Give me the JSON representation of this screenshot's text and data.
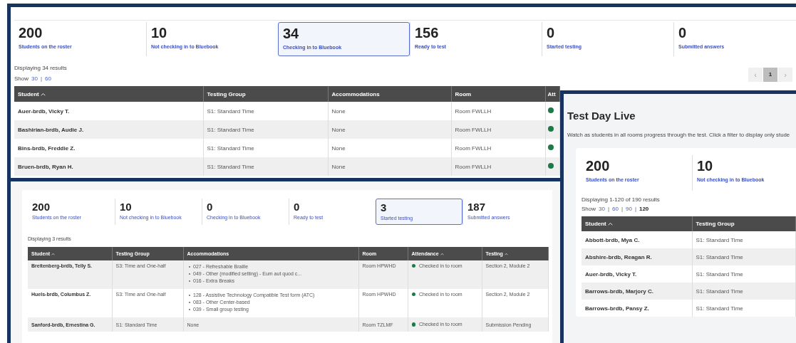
{
  "panels": [
    {
      "stats": [
        {
          "value": "200",
          "label": "Students on the roster",
          "selected": false
        },
        {
          "value": "10",
          "label": "Not checking in to Bluebook",
          "selected": false
        },
        {
          "value": "34",
          "label": "Checking in to Bluebook",
          "selected": true
        },
        {
          "value": "156",
          "label": "Ready to test",
          "selected": false
        },
        {
          "value": "0",
          "label": "Started testing",
          "selected": false
        },
        {
          "value": "0",
          "label": "Submitted answers",
          "selected": false
        }
      ],
      "results": "Displaying 34 results",
      "page_sizes": {
        "label": "Show",
        "separator": "|",
        "options": [
          {
            "label": "30",
            "selected": false
          },
          {
            "label": "60",
            "selected": false
          }
        ]
      },
      "pager": {
        "prev": "‹",
        "pages": [
          {
            "label": "1",
            "selected": true
          }
        ],
        "next": "›"
      },
      "table": {
        "columns": [
          {
            "label": "Student",
            "kind": "name",
            "sorted": true
          },
          {
            "label": "Testing Group",
            "kind": "text",
            "sorted": false
          },
          {
            "label": "Accommodations",
            "kind": "list",
            "sorted": false
          },
          {
            "label": "Room",
            "kind": "text",
            "sorted": false
          },
          {
            "label": "Att",
            "kind": "status"
          }
        ],
        "rows": [
          [
            "Auer-brdb, Vicky T.",
            "S1: Standard Time",
            "None",
            "Room FWLLH",
            true
          ],
          [
            "Bashirian-brdb, Audie J.",
            "S1: Standard Time",
            "None",
            "Room FWLLH",
            true
          ],
          [
            "Bins-brdb, Freddie Z.",
            "S1: Standard Time",
            "None",
            "Room FWLLH",
            true
          ],
          [
            "Bruen-brdb, Ryan H.",
            "S1: Standard Time",
            "None",
            "Room FWLLH",
            true
          ]
        ]
      }
    },
    {
      "stats": [
        {
          "value": "200",
          "label": "Students on the roster",
          "selected": false
        },
        {
          "value": "10",
          "label": "Not checking in to Bluebook",
          "selected": false
        },
        {
          "value": "0",
          "label": "Checking in to Bluebook",
          "selected": false
        },
        {
          "value": "0",
          "label": "Ready to test",
          "selected": false
        },
        {
          "value": "3",
          "label": "Started testing",
          "selected": true
        },
        {
          "value": "187",
          "label": "Submitted answers",
          "selected": false
        }
      ],
      "results": "Displaying 3 results",
      "table": {
        "columns": [
          {
            "label": "Student",
            "kind": "name",
            "sorted": true
          },
          {
            "label": "Testing Group",
            "kind": "text",
            "sorted": false
          },
          {
            "label": "Accommodations",
            "kind": "list",
            "sorted": false
          },
          {
            "label": "Room",
            "kind": "text",
            "sorted": false
          },
          {
            "label": "Attendance",
            "kind": "status",
            "sorted": true
          },
          {
            "label": "Testing",
            "kind": "text",
            "sorted": true
          }
        ],
        "rows": [
          [
            "Breitenberg-brdb, Telly S.",
            "S3: Time and One-half",
            [
              "027 - Refreshable Braille",
              "049 - Other (modified setting) - Eum aut quod c...",
              "016 - Extra Breaks"
            ],
            "Room HPWHD",
            "Checked in to room",
            "Section 2, Module 2"
          ],
          [
            "Huels-brdb, Columbus Z.",
            "S3: Time and One-half",
            [
              "128 - Assistive Technology Compatible Test form (ATC)",
              "083 - Other Center-based",
              "039 - Small group testing"
            ],
            "Room HPWHD",
            "Checked in to room",
            "Section 2, Module 2"
          ],
          [
            "Sanford-brdb, Ernestina G.",
            "S1: Standard Time",
            "None",
            "Room TZLMF",
            "Checked in to room",
            "Submission Pending"
          ]
        ]
      }
    },
    {
      "title": "Test Day Live",
      "description": "Watch as students in all rooms progress through the test. Click a filter to display only stude",
      "stats": [
        {
          "value": "200",
          "label": "Students on the roster",
          "selected": false
        },
        {
          "value": "10",
          "label": "Not checking in to Bluebook",
          "selected": false
        }
      ],
      "results": "Displaying 1-120 of 190 results",
      "page_sizes": {
        "label": "Show",
        "separator": "|",
        "options": [
          {
            "label": "30",
            "selected": false
          },
          {
            "label": "60",
            "selected": false
          },
          {
            "label": "90",
            "selected": false
          },
          {
            "label": "120",
            "selected": true
          }
        ]
      },
      "table": {
        "columns": [
          {
            "label": "Student",
            "kind": "name",
            "sorted": true
          },
          {
            "label": "Testing Group",
            "kind": "text",
            "sorted": false
          }
        ],
        "rows": [
          [
            "Abbott-brdb, Mya C.",
            "S1: Standard Time"
          ],
          [
            "Abshire-brdb, Reagan R.",
            "S1: Standard Time"
          ],
          [
            "Auer-brdb, Vicky T.",
            "S1: Standard Time"
          ],
          [
            "Barrows-brdb, Marjory C.",
            "S1: Standard Time"
          ],
          [
            "Barrows-brdb, Pansy Z.",
            "S1: Standard Time"
          ]
        ]
      }
    }
  ]
}
